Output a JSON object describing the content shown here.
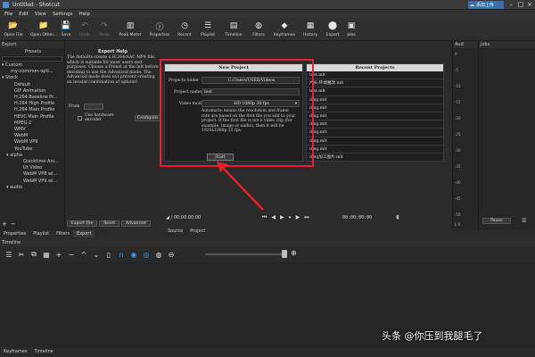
{
  "window": {
    "title": "Untitled - Shotcut"
  },
  "cloud_button": "添加上传",
  "menu": [
    "File",
    "Edit",
    "View",
    "Settings",
    "Help"
  ],
  "toolbar": [
    {
      "label": "Open File",
      "icon": "open-file-icon",
      "enabled": true
    },
    {
      "label": "Open Other...",
      "icon": "open-other-icon",
      "enabled": true
    },
    {
      "label": "Save",
      "icon": "save-icon",
      "enabled": true
    },
    {
      "label": "Undo",
      "icon": "undo-icon",
      "enabled": false
    },
    {
      "label": "Redo",
      "icon": "redo-icon",
      "enabled": false
    },
    {
      "label": "Peak Meter",
      "icon": "peak-meter-icon",
      "enabled": true
    },
    {
      "label": "Properties",
      "icon": "properties-icon",
      "enabled": true
    },
    {
      "label": "Recent",
      "icon": "recent-icon",
      "enabled": true
    },
    {
      "label": "Playlist",
      "icon": "playlist-icon",
      "enabled": true
    },
    {
      "label": "Timeline",
      "icon": "timeline-icon",
      "enabled": true
    },
    {
      "label": "Filters",
      "icon": "filters-icon",
      "enabled": true
    },
    {
      "label": "Keyframes",
      "icon": "keyframes-icon",
      "enabled": true
    },
    {
      "label": "History",
      "icon": "history-icon",
      "enabled": true
    },
    {
      "label": "Export",
      "icon": "export-icon",
      "enabled": true
    },
    {
      "label": "Jobs",
      "icon": "jobs-icon",
      "enabled": true
    }
  ],
  "export_panel": {
    "title": "Export",
    "presets_title": "Presets",
    "tree": [
      "Custom",
      "my-common-opti...",
      "Stock",
      "Default",
      "GIF Animation",
      "H.264 Baseline Pr...",
      "H.264 High Profile",
      "H.264 Main Profile",
      "HEVC Main Profile",
      "MPEG-2",
      "WMV",
      "WebM",
      "WebM VP9",
      "YouTube",
      "alpha",
      "Quicktime Ani...",
      "Ut Video",
      "WebM VP8 wi...",
      "WebM VP9 wi...",
      "audio"
    ],
    "help_title": "Export Help",
    "help_text": "The defaults create a H.264/AAC MP4 file, which is suitable for most users and purposes. Choose a Preset at the left before deciding to use the Advanced mode. The Advanced mode does not prevent creating an invalid combination of options!",
    "from_label": "From",
    "hw_label": "Use hardware encoder",
    "configure_label": "Configure",
    "buttons": [
      "Export File",
      "Reset",
      "Advanced"
    ]
  },
  "new_project": {
    "title": "New Project",
    "folder_label": "Projects folder",
    "folder_value": "C:/Users/USER/Videos",
    "name_label": "Project name",
    "name_value": "test",
    "mode_label": "Video mode",
    "mode_value": "HD 1080p 30 fps",
    "info": "Automatic means the resolution and frame rate are based on the first file you add to your project. If the first file is not a video clip (for example, image or audio), then it will be 1920x1080p 25 fps.",
    "start_label": "Start"
  },
  "recent_projects": {
    "title": "Recent Projects",
    "items": [
      "test.mlt",
      "片头-环境魔改.mlt",
      "test.mlt",
      "ding.mlt",
      "ding.mlt",
      "ding.mlt",
      "ding.mlt",
      "ding.mlt",
      "ding.mlt",
      "ding.mlt",
      "ding加工图片.mlt",
      "ding.mlt"
    ]
  },
  "transport": {
    "time_a": "/ 00:00:00:00",
    "time_b": "00:00:00:00"
  },
  "left_tabs": [
    "Properties",
    "Playlist",
    "Filters",
    "Export"
  ],
  "source_tabs": [
    "Source",
    "Project"
  ],
  "audio_panel": {
    "title": "Aud",
    "scale": [
      "0",
      "-5",
      "-10",
      "-15",
      "-20",
      "-25",
      "-30",
      "-35",
      "-40",
      "-45",
      "-50"
    ],
    "lr": "L R"
  },
  "jobs_panel": {
    "title": "Jobs",
    "pause_label": "Pause"
  },
  "timeline": {
    "title": "Timeline"
  },
  "bottom_tabs": [
    "Keyframes",
    "Timeline"
  ],
  "watermark": "头条 @你压到我腿毛了",
  "colors": {
    "highlight": "#e8222d",
    "accent": "#3aa0ff"
  }
}
